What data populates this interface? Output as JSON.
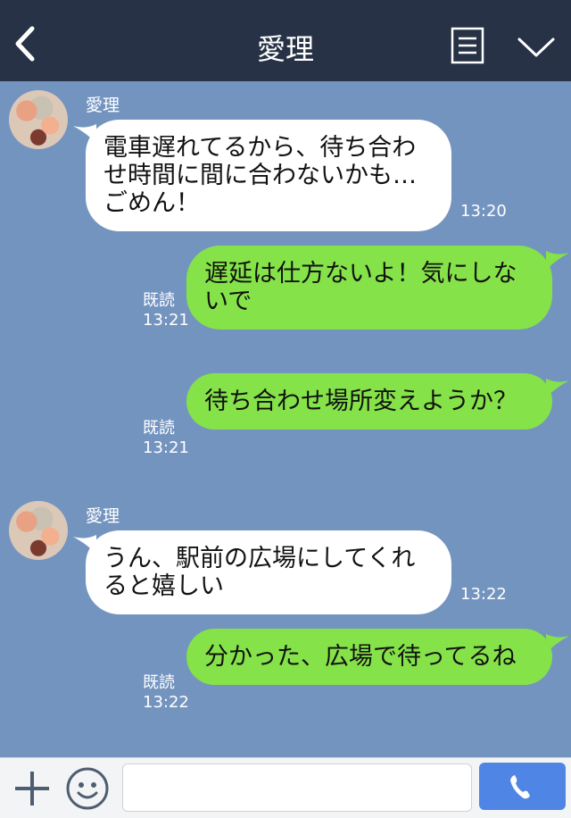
{
  "header": {
    "title": "愛理",
    "back_icon": "chevron-left-icon",
    "notes_icon": "notes-icon",
    "menu_icon": "chevron-down-icon"
  },
  "messages": [
    {
      "direction": "in",
      "sender": "愛理",
      "text": "電車遅れてるから、待ち合わせ時間に間に合わないかも…ごめん！",
      "time": "13:20"
    },
    {
      "direction": "out",
      "read_label": "既読",
      "text": "遅延は仕方ないよ！気にしないで",
      "time": "13:21"
    },
    {
      "direction": "out",
      "read_label": "既読",
      "text": "待ち合わせ場所変えようか？",
      "time": "13:21"
    },
    {
      "direction": "in",
      "sender": "愛理",
      "text": "うん、駅前の広場にしてくれると嬉しい",
      "time": "13:22"
    },
    {
      "direction": "out",
      "read_label": "既読",
      "text": "分かった、広場で待ってるね",
      "time": "13:22"
    }
  ],
  "footer": {
    "plus_icon": "plus-icon",
    "emoji_icon": "emoji-icon",
    "input_value": "",
    "send_icon": "phone-icon"
  },
  "colors": {
    "header_bg": "#273246",
    "chat_bg": "#7494c0",
    "outgoing_bubble": "#85e249",
    "incoming_bubble": "#ffffff",
    "send_button": "#4f86e6"
  }
}
